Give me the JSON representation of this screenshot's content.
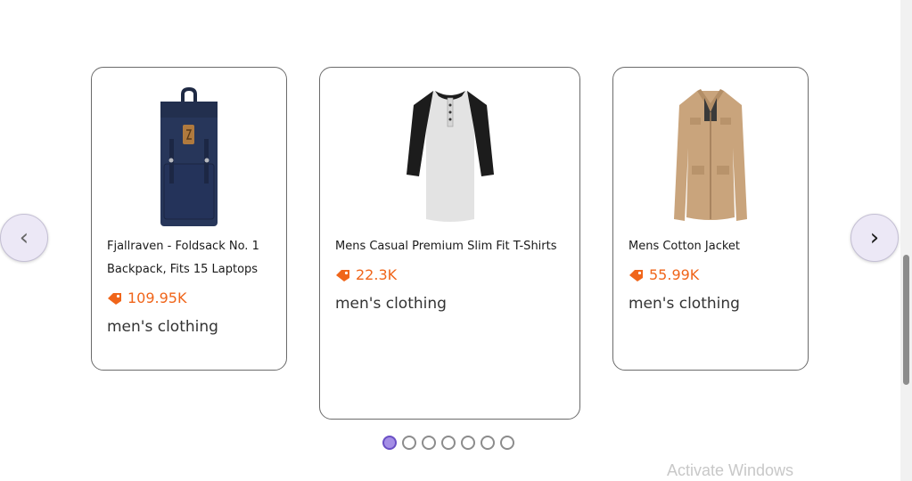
{
  "carousel": {
    "prev_glyph": "‹",
    "next_glyph": "›",
    "products": [
      {
        "title_line1": "Fjallraven - Foldsack No. 1",
        "title_line2": "Backpack, Fits 15 Laptops",
        "price": "109.95K",
        "category": "men's clothing",
        "image": "navy-backpack"
      },
      {
        "title_line1": "Mens Casual Premium Slim Fit T-Shirts",
        "title_line2": "",
        "price": "22.3K",
        "category": "men's clothing",
        "image": "raglan-henley-shirt"
      },
      {
        "title_line1": "Mens Cotton Jacket",
        "title_line2": "",
        "price": "55.99K",
        "category": "men's clothing",
        "image": "khaki-jacket"
      }
    ],
    "dots_count": 7,
    "active_dot": 0,
    "colors": {
      "price": "#f0651a",
      "active_dot": "#a48ee6",
      "nav_button_bg": "#ece8f6"
    }
  },
  "watermark": "Activate Windows",
  "icons": {
    "price": "price-tag-icon",
    "prev": "chevron-left-icon",
    "next": "chevron-right-icon"
  }
}
